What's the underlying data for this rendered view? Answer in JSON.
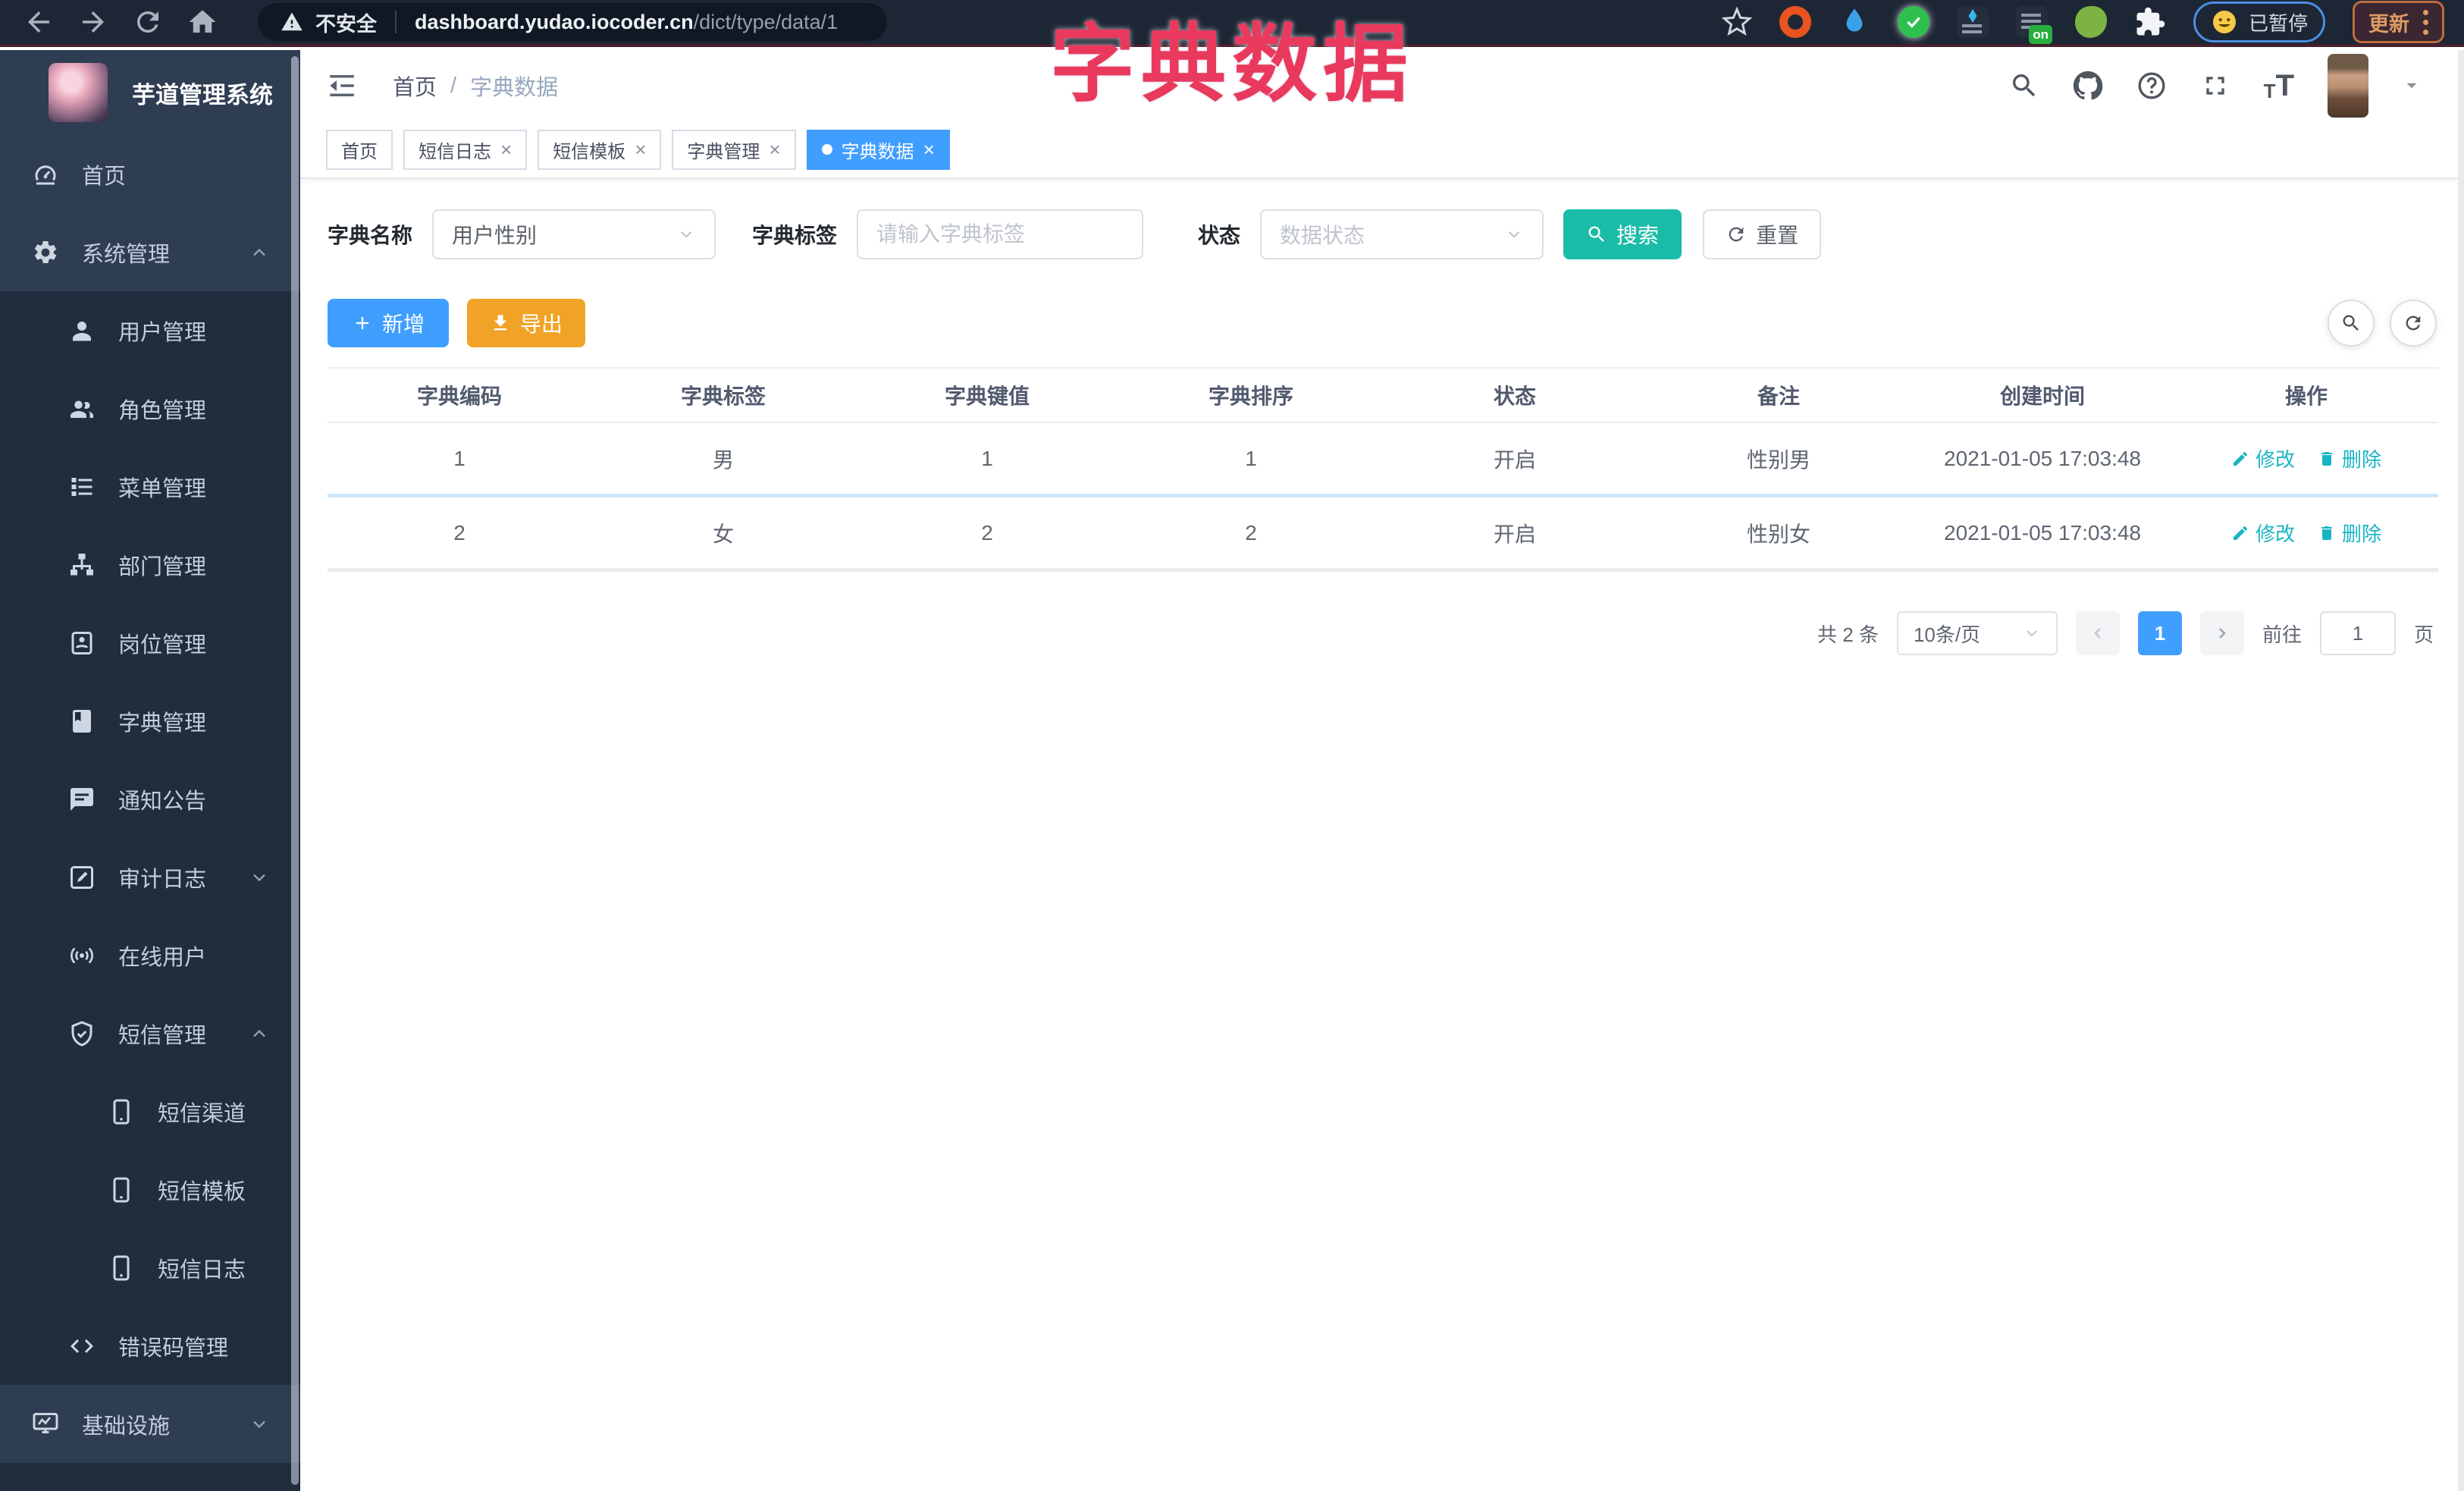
{
  "browser": {
    "security_label": "不安全",
    "url_host": "dashboard.yudao.iocoder.cn",
    "url_path": "/dict/type/data/1",
    "extension_badge": "on",
    "paused_label": "已暂停",
    "update_label": "更新"
  },
  "overlay_title": "字典数据",
  "sidebar": {
    "logo_title": "芋道管理系统",
    "items": [
      {
        "label": "首页"
      },
      {
        "label": "系统管理"
      },
      {
        "label": "用户管理"
      },
      {
        "label": "角色管理"
      },
      {
        "label": "菜单管理"
      },
      {
        "label": "部门管理"
      },
      {
        "label": "岗位管理"
      },
      {
        "label": "字典管理"
      },
      {
        "label": "通知公告"
      },
      {
        "label": "审计日志"
      },
      {
        "label": "在线用户"
      },
      {
        "label": "短信管理"
      },
      {
        "label": "短信渠道"
      },
      {
        "label": "短信模板"
      },
      {
        "label": "短信日志"
      },
      {
        "label": "错误码管理"
      },
      {
        "label": "基础设施"
      }
    ]
  },
  "navbar": {
    "breadcrumb_home": "首页",
    "breadcrumb_sep": "/",
    "breadcrumb_current": "字典数据",
    "font_small_t": "T",
    "font_big_t": "T"
  },
  "tags": [
    {
      "label": "首页"
    },
    {
      "label": "短信日志"
    },
    {
      "label": "短信模板"
    },
    {
      "label": "字典管理"
    },
    {
      "label": "字典数据"
    }
  ],
  "filters": {
    "dict_name_label": "字典名称",
    "dict_name_value": "用户性别",
    "dict_label_label": "字典标签",
    "dict_label_placeholder": "请输入字典标签",
    "status_label": "状态",
    "status_placeholder": "数据状态",
    "search_button": "搜索",
    "reset_button": "重置"
  },
  "toolbar": {
    "add_button": "新增",
    "export_button": "导出"
  },
  "table": {
    "headers": [
      "字典编码",
      "字典标签",
      "字典键值",
      "字典排序",
      "状态",
      "备注",
      "创建时间",
      "操作"
    ],
    "rows": [
      {
        "code": "1",
        "label": "男",
        "value": "1",
        "sort": "1",
        "status": "开启",
        "remark": "性别男",
        "created": "2021-01-05 17:03:48",
        "edit": "修改",
        "delete": "删除"
      },
      {
        "code": "2",
        "label": "女",
        "value": "2",
        "sort": "2",
        "status": "开启",
        "remark": "性别女",
        "created": "2021-01-05 17:03:48",
        "edit": "修改",
        "delete": "删除"
      }
    ]
  },
  "pagination": {
    "total": "共 2 条",
    "page_size": "10条/页",
    "page": "1",
    "goto_label": "前往",
    "goto_value": "1",
    "unit_label": "页"
  },
  "colors": {
    "accent_blue": "#409eff",
    "search_teal": "#1abca8",
    "link_teal": "#1ab5c3",
    "export_orange": "#f0a326",
    "overlay_pink": "#e9395c",
    "sidebar_bg": "#2f3d52",
    "sidebar_sub_bg": "#1f2d3d"
  },
  "icons": {
    "back": "left-arrow",
    "forward": "right-arrow",
    "reload": "circular-arrow",
    "home": "house",
    "warning": "triangle-exclaim",
    "star": "outline-star",
    "puzzle": "puzzle-piece",
    "search": "magnifier",
    "github": "octocat",
    "help": "question-circle",
    "fullscreen": "corner-arrows",
    "font_size": "tT",
    "caret": "down-triangle",
    "fold": "indent-lines",
    "add": "plus",
    "export": "download-arrow",
    "edit": "pencil",
    "delete": "trash",
    "refresh": "circular-arrow"
  }
}
